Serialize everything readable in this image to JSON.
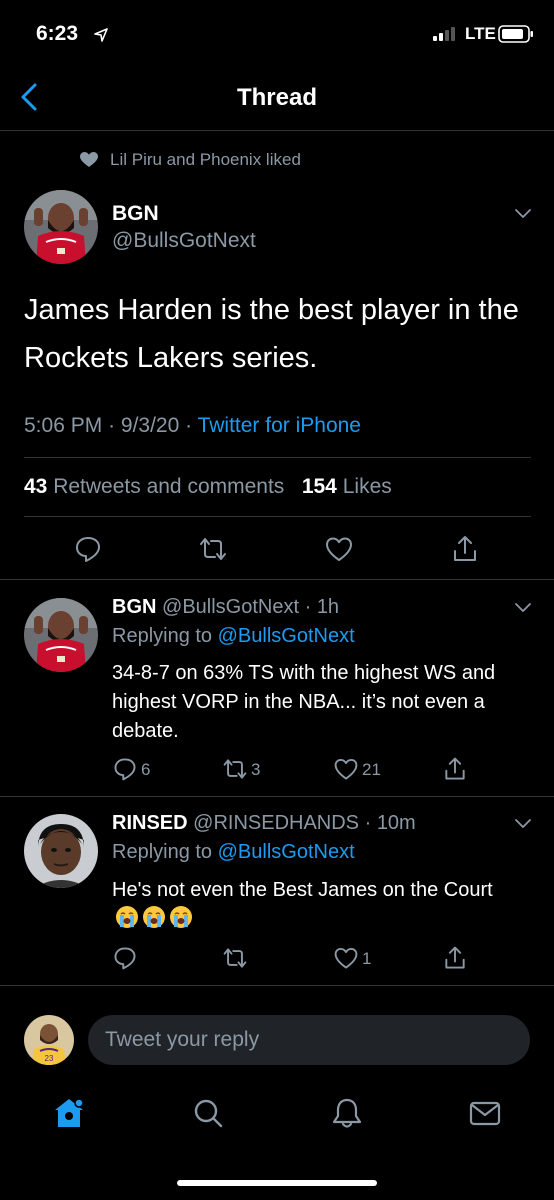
{
  "status": {
    "time": "6:23",
    "network": "LTE"
  },
  "nav": {
    "title": "Thread"
  },
  "social_context": "Lil Piru and Phoenix liked",
  "main_tweet": {
    "name": "BGN",
    "handle": "@BullsGotNext",
    "text": "James Harden is the best player in the Rockets Lakers series.",
    "time": "5:06 PM",
    "date": "9/3/20",
    "source": "Twitter for iPhone",
    "retweets_count": "43",
    "retweets_label": "Retweets and comments",
    "likes_count": "154",
    "likes_label": "Likes"
  },
  "replies": [
    {
      "name": "BGN",
      "handle": "@BullsGotNext",
      "time": "1h",
      "replying_label": "Replying to",
      "replying_to": "@BullsGotNext",
      "text": "34-8-7 on 63% TS with the highest WS and highest VORP in the NBA... it’s not even a debate.",
      "reply_count": "6",
      "retweet_count": "3",
      "like_count": "21"
    },
    {
      "name": "RINSED",
      "handle": "@RINSEDHANDS",
      "time": "10m",
      "replying_label": "Replying to",
      "replying_to": "@BullsGotNext",
      "text": "He's not even the Best James on the Court",
      "reply_count": "",
      "retweet_count": "",
      "like_count": "1"
    }
  ],
  "composer": {
    "placeholder": "Tweet your reply"
  },
  "icons": {
    "back": "chevron-left-icon",
    "reply": "speech-bubble-icon",
    "retweet": "retweet-icon",
    "like": "heart-icon",
    "share": "share-icon",
    "home": "home-icon",
    "search": "search-icon",
    "notifications": "bell-icon",
    "messages": "envelope-icon"
  },
  "colors": {
    "accent": "#1d9bf0",
    "muted": "#8b98a5",
    "background": "#000000"
  }
}
